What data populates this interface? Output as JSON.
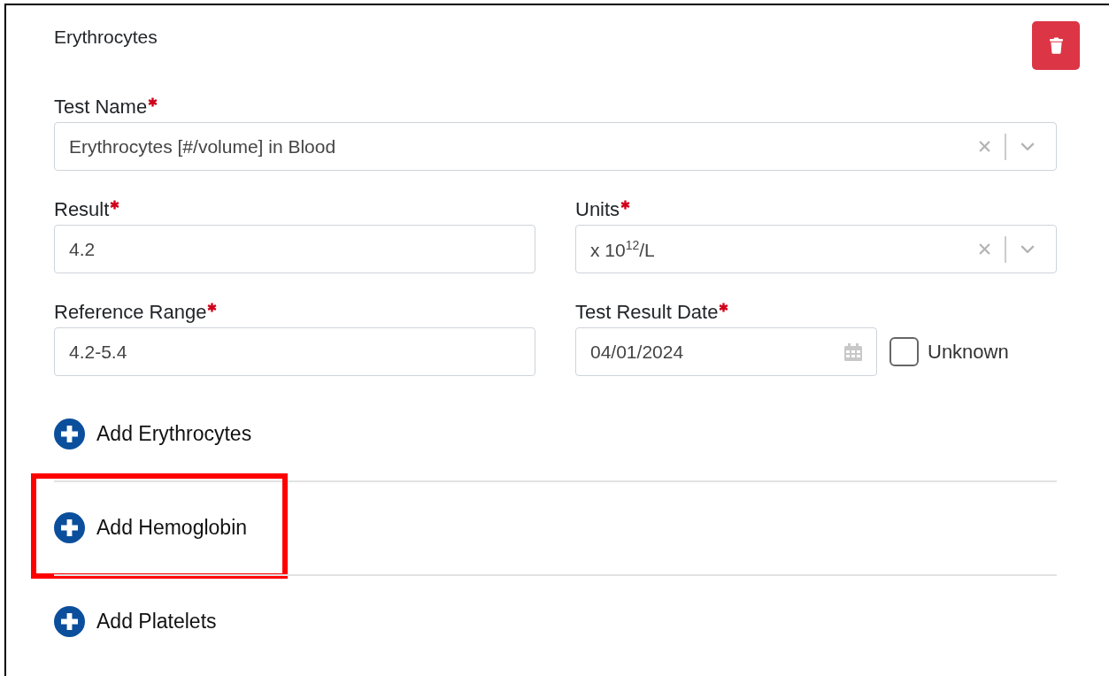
{
  "section": {
    "title": "Erythrocytes",
    "delete_button": {
      "kind": "delete"
    }
  },
  "field_rows": [
    [
      {
        "kind": "select",
        "label": "Test Name",
        "required": true,
        "value": "Erythrocytes [#/volume] in Blood"
      }
    ],
    [
      {
        "kind": "text",
        "label": "Result",
        "required": true,
        "value": "4.2"
      },
      {
        "kind": "select",
        "label": "Units",
        "required": true,
        "value": "x 10$^{12}$/L"
      }
    ],
    [
      {
        "kind": "text",
        "label": "Reference Range",
        "required": true,
        "value": "4.2-5.4"
      },
      {
        "kind": "date",
        "label": "Test Result Date",
        "required": true,
        "value": "04/01/2024",
        "unknown": {
          "label": "Unknown",
          "checked": false
        }
      }
    ]
  ],
  "add_links": [
    {
      "label": "Add Erythrocytes",
      "highlighted": false,
      "divider": false
    },
    {
      "label": "Add Hemoglobin",
      "highlighted": true,
      "divider": true
    },
    {
      "label": "Add Platelets",
      "highlighted": false,
      "divider": true
    }
  ]
}
